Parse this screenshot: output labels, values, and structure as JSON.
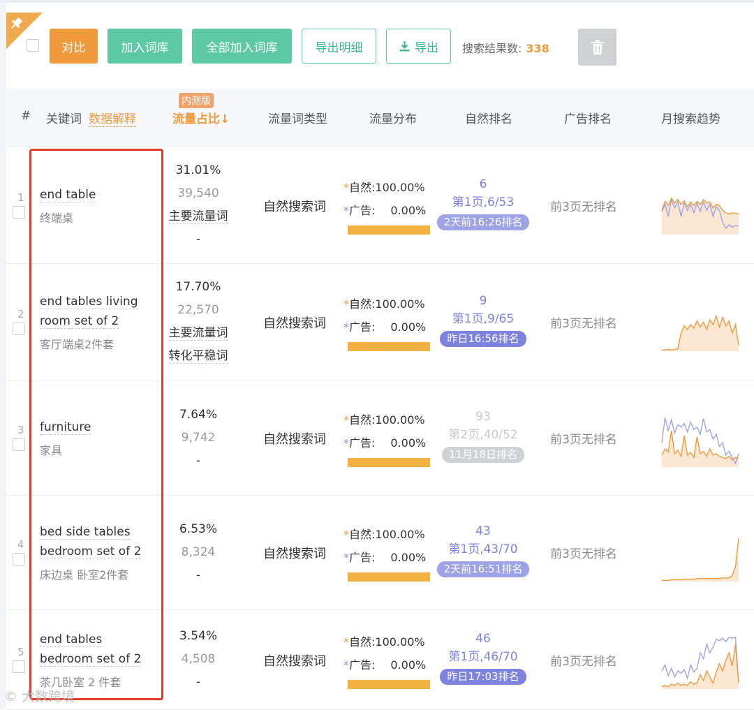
{
  "toolbar": {
    "compare_label": "对比",
    "add_to_lib_label": "加入词库",
    "add_all_label": "全部加入词库",
    "export_detail_label": "导出明细",
    "export_label": "导出",
    "result_label": "搜索结果数:",
    "result_count": "338"
  },
  "header": {
    "index": "#",
    "keyword": "关键词",
    "data_explain": "数据解释",
    "beta_badge": "内测版",
    "traffic_share": "流量占比↓",
    "keyword_type": "流量词类型",
    "traffic_dist": "流量分布",
    "organic_rank": "自然排名",
    "ad_rank": "广告排名",
    "monthly_trend": "月搜索趋势"
  },
  "colors": {
    "orange": "#ef9a3d",
    "green": "#5cc9a4",
    "purple": "#7d82de",
    "bar": "#f2b140",
    "highlight": "#e03c2d"
  },
  "rows": [
    {
      "index": "1",
      "keyword_lines": [
        "end table"
      ],
      "keyword_cn": "终端桌",
      "share": "31.01%",
      "volume": "39,540",
      "tags": [
        "主要流量词"
      ],
      "extra": "-",
      "type": "自然搜索词",
      "dist_organic": "自然:100.00%",
      "dist_ad": "广告:",
      "dist_ad_value": "0.00%",
      "organic_fraction": 1.0,
      "rank_num": "6",
      "rank_page": "第1页,6/53",
      "rank_time": "2天前16:26排名",
      "rank_time_color": "#9ea3e6",
      "ad_rank": "前3页无排名",
      "trend": {
        "orange": [
          40,
          55,
          48,
          60,
          52,
          58,
          50,
          56,
          46,
          54,
          48,
          55,
          50,
          58,
          52,
          54,
          44,
          50,
          48,
          40,
          36,
          34,
          36,
          35,
          34
        ],
        "purple": [
          38,
          50,
          30,
          58,
          44,
          54,
          30,
          52,
          40,
          50,
          36,
          52,
          38,
          54,
          40,
          50,
          30,
          46,
          40,
          20,
          10,
          16,
          12,
          15,
          14
        ]
      }
    },
    {
      "index": "2",
      "keyword_lines": [
        "end tables living",
        "room set of 2"
      ],
      "keyword_cn": "客厅端桌2件套",
      "share": "17.70%",
      "volume": "22,570",
      "tags": [
        "主要流量词",
        "转化平稳词"
      ],
      "extra": "",
      "type": "自然搜索词",
      "dist_organic": "自然:100.00%",
      "dist_ad": "广告:",
      "dist_ad_value": "0.00%",
      "organic_fraction": 1.0,
      "rank_num": "9",
      "rank_page": "第1页,9/65",
      "rank_time": "昨日16:56排名",
      "rank_time_color": "#7d82de",
      "ad_rank": "前3页无排名",
      "trend": {
        "orange": [
          2,
          2,
          3,
          2,
          3,
          4,
          30,
          42,
          36,
          44,
          38,
          50,
          40,
          48,
          36,
          52,
          44,
          58,
          40,
          56,
          42,
          50,
          30,
          44,
          10
        ],
        "purple": []
      }
    },
    {
      "index": "3",
      "keyword_lines": [
        "furniture"
      ],
      "keyword_cn": "家具",
      "share": "7.64%",
      "volume": "9,742",
      "tags": [],
      "extra": "-",
      "type": "自然搜索词",
      "dist_organic": "自然:100.00%",
      "dist_ad": "广告:",
      "dist_ad_value": "0.00%",
      "organic_fraction": 1.0,
      "rank_num": "93",
      "rank_page": "第2页,40/52",
      "rank_time": "11月18日排名",
      "rank_time_color": "#cfd1d5",
      "ad_rank": "前3页无排名",
      "trend": {
        "orange": [
          20,
          30,
          25,
          60,
          22,
          28,
          18,
          52,
          20,
          24,
          16,
          50,
          22,
          26,
          18,
          30,
          20,
          22,
          18,
          16,
          14,
          18,
          12,
          16,
          14
        ],
        "purple": [
          40,
          82,
          60,
          78,
          56,
          70,
          66,
          72,
          58,
          74,
          62,
          66,
          54,
          80,
          58,
          62,
          46,
          54,
          34,
          40,
          20,
          26,
          16,
          6,
          22
        ]
      }
    },
    {
      "index": "4",
      "keyword_lines": [
        "bed side tables",
        "bedroom set of 2"
      ],
      "keyword_cn": "床边桌 卧室2件套",
      "share": "6.53%",
      "volume": "8,324",
      "tags": [],
      "extra": "-",
      "type": "自然搜索词",
      "dist_organic": "自然:100.00%",
      "dist_ad": "广告:",
      "dist_ad_value": "0.00%",
      "organic_fraction": 1.0,
      "rank_num": "43",
      "rank_page": "第1页,43/70",
      "rank_time": "2天前16:51排名",
      "rank_time_color": "#9ea3e6",
      "ad_rank": "前3页无排名",
      "trend": {
        "orange": [
          2,
          2,
          2,
          3,
          3,
          3,
          3,
          4,
          4,
          4,
          4,
          5,
          5,
          5,
          5,
          5,
          5,
          5,
          5,
          6,
          6,
          6,
          10,
          24,
          72
        ],
        "purple": []
      }
    },
    {
      "index": "5",
      "keyword_lines": [
        "end tables",
        "bedroom set of 2"
      ],
      "keyword_cn": "茶几卧室 2 件套",
      "share": "3.54%",
      "volume": "4,508",
      "tags": [],
      "extra": "-",
      "type": "自然搜索词",
      "dist_organic": "自然:100.00%",
      "dist_ad": "广告:",
      "dist_ad_value": "0.00%",
      "organic_fraction": 1.0,
      "rank_num": "46",
      "rank_page": "第1页,46/70",
      "rank_time": "昨日17:03排名",
      "rank_time_color": "#7d82de",
      "ad_rank": "前3页无排名",
      "trend": {
        "orange": [
          4,
          6,
          4,
          8,
          6,
          10,
          6,
          8,
          6,
          12,
          8,
          10,
          24,
          14,
          30,
          20,
          10,
          28,
          42,
          30,
          48,
          60,
          38,
          74,
          10
        ],
        "purple": [
          30,
          40,
          22,
          34,
          20,
          30,
          26,
          32,
          18,
          40,
          28,
          34,
          60,
          50,
          74,
          60,
          70,
          82,
          80,
          84,
          78,
          86,
          84,
          86,
          10
        ]
      }
    }
  ],
  "watermark": "© 大数跨境"
}
